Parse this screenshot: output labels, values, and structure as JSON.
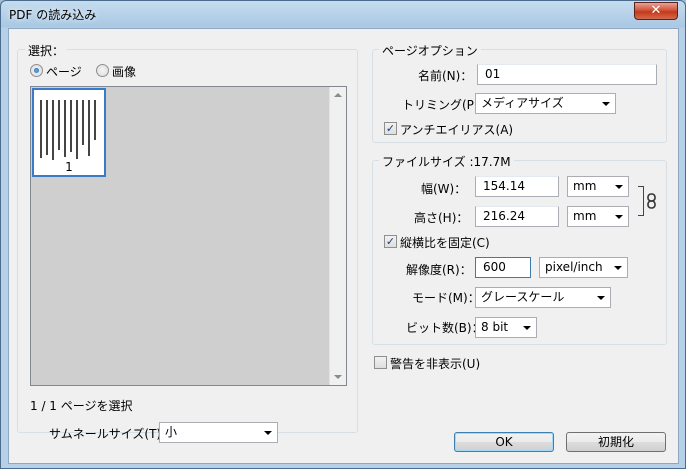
{
  "window": {
    "title": "PDF の読み込み",
    "close_glyph": "✕"
  },
  "selection": {
    "group_title": "選択：",
    "radio_page": "ページ",
    "radio_image": "画像",
    "selected": "ページ",
    "thumbnails": [
      {
        "page_number": "1",
        "selected": true
      }
    ],
    "status": "1 / 1 ページを選択",
    "thumb_size_label": "サムネールサイズ(T)：",
    "thumb_size_value": "小"
  },
  "page_options": {
    "group_title": "ページオプション",
    "name_label": "名前(N)：",
    "name_value": "01",
    "crop_label": "トリミング(P)：",
    "crop_value": "メディアサイズ",
    "antialias_label": "アンチエイリアス(A)",
    "antialias_checked": true
  },
  "image_size": {
    "group_title": "ファイルサイズ :17.7M",
    "width_label": "幅(W)：",
    "width_value": "154.14",
    "width_unit": "mm",
    "height_label": "高さ(H)：",
    "height_value": "216.24",
    "height_unit": "mm",
    "constrain_label": "縦横比を固定(C)",
    "constrain_checked": true,
    "resolution_label": "解像度(R)：",
    "resolution_value": "600",
    "resolution_unit": "pixel/inch",
    "mode_label": "モード(M)：",
    "mode_value": "グレースケール",
    "bits_label": "ビット数(B)：",
    "bits_value": "8 bit"
  },
  "suppress_warnings": {
    "label": "警告を非表示(U)",
    "checked": false
  },
  "buttons": {
    "ok": "OK",
    "reset": "初期化"
  },
  "colors": {
    "accent": "#3b79c9",
    "frame": "#b6d0e8",
    "close": "#c3391b"
  }
}
